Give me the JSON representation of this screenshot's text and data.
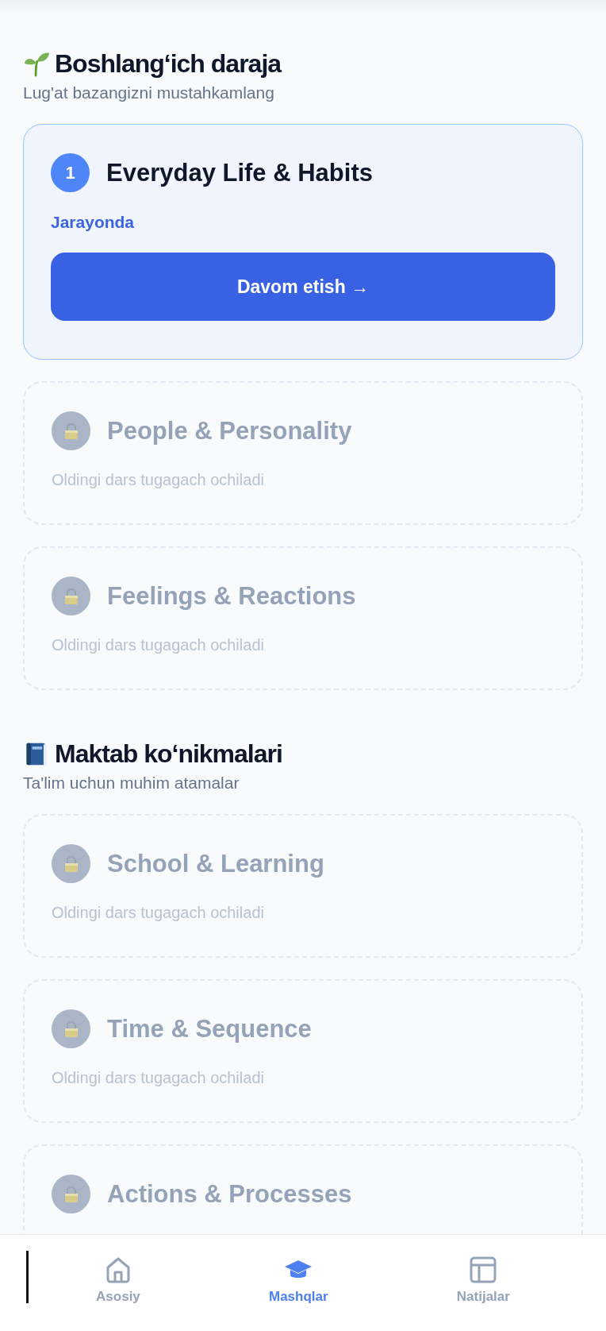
{
  "sections": [
    {
      "title": "Boshlang‘ich daraja",
      "subtitle": "Lug'at bazangizni mustahkamlang",
      "lessons": [
        {
          "kind": "active",
          "number": "1",
          "title": "Everyday Life & Habits",
          "status": "Jarayonda",
          "button": "Davom etish →"
        },
        {
          "kind": "locked",
          "title": "People & Personality",
          "note": "Oldingi dars tugagach ochiladi"
        },
        {
          "kind": "locked",
          "title": "Feelings & Reactions",
          "note": "Oldingi dars tugagach ochiladi"
        }
      ]
    },
    {
      "title": "Maktab ko‘nikmalari",
      "subtitle": "Ta'lim uchun muhim atamalar",
      "lessons": [
        {
          "kind": "locked",
          "title": "School & Learning",
          "note": "Oldingi dars tugagach ochiladi"
        },
        {
          "kind": "locked",
          "title": "Time & Sequence",
          "note": "Oldingi dars tugagach ochiladi"
        },
        {
          "kind": "locked",
          "title": "Actions & Processes"
        }
      ]
    }
  ],
  "bottom_nav": [
    {
      "label": "Asosiy",
      "selected": false
    },
    {
      "label": "Mashqlar",
      "selected": true
    },
    {
      "label": "Natijalar",
      "selected": false
    }
  ]
}
